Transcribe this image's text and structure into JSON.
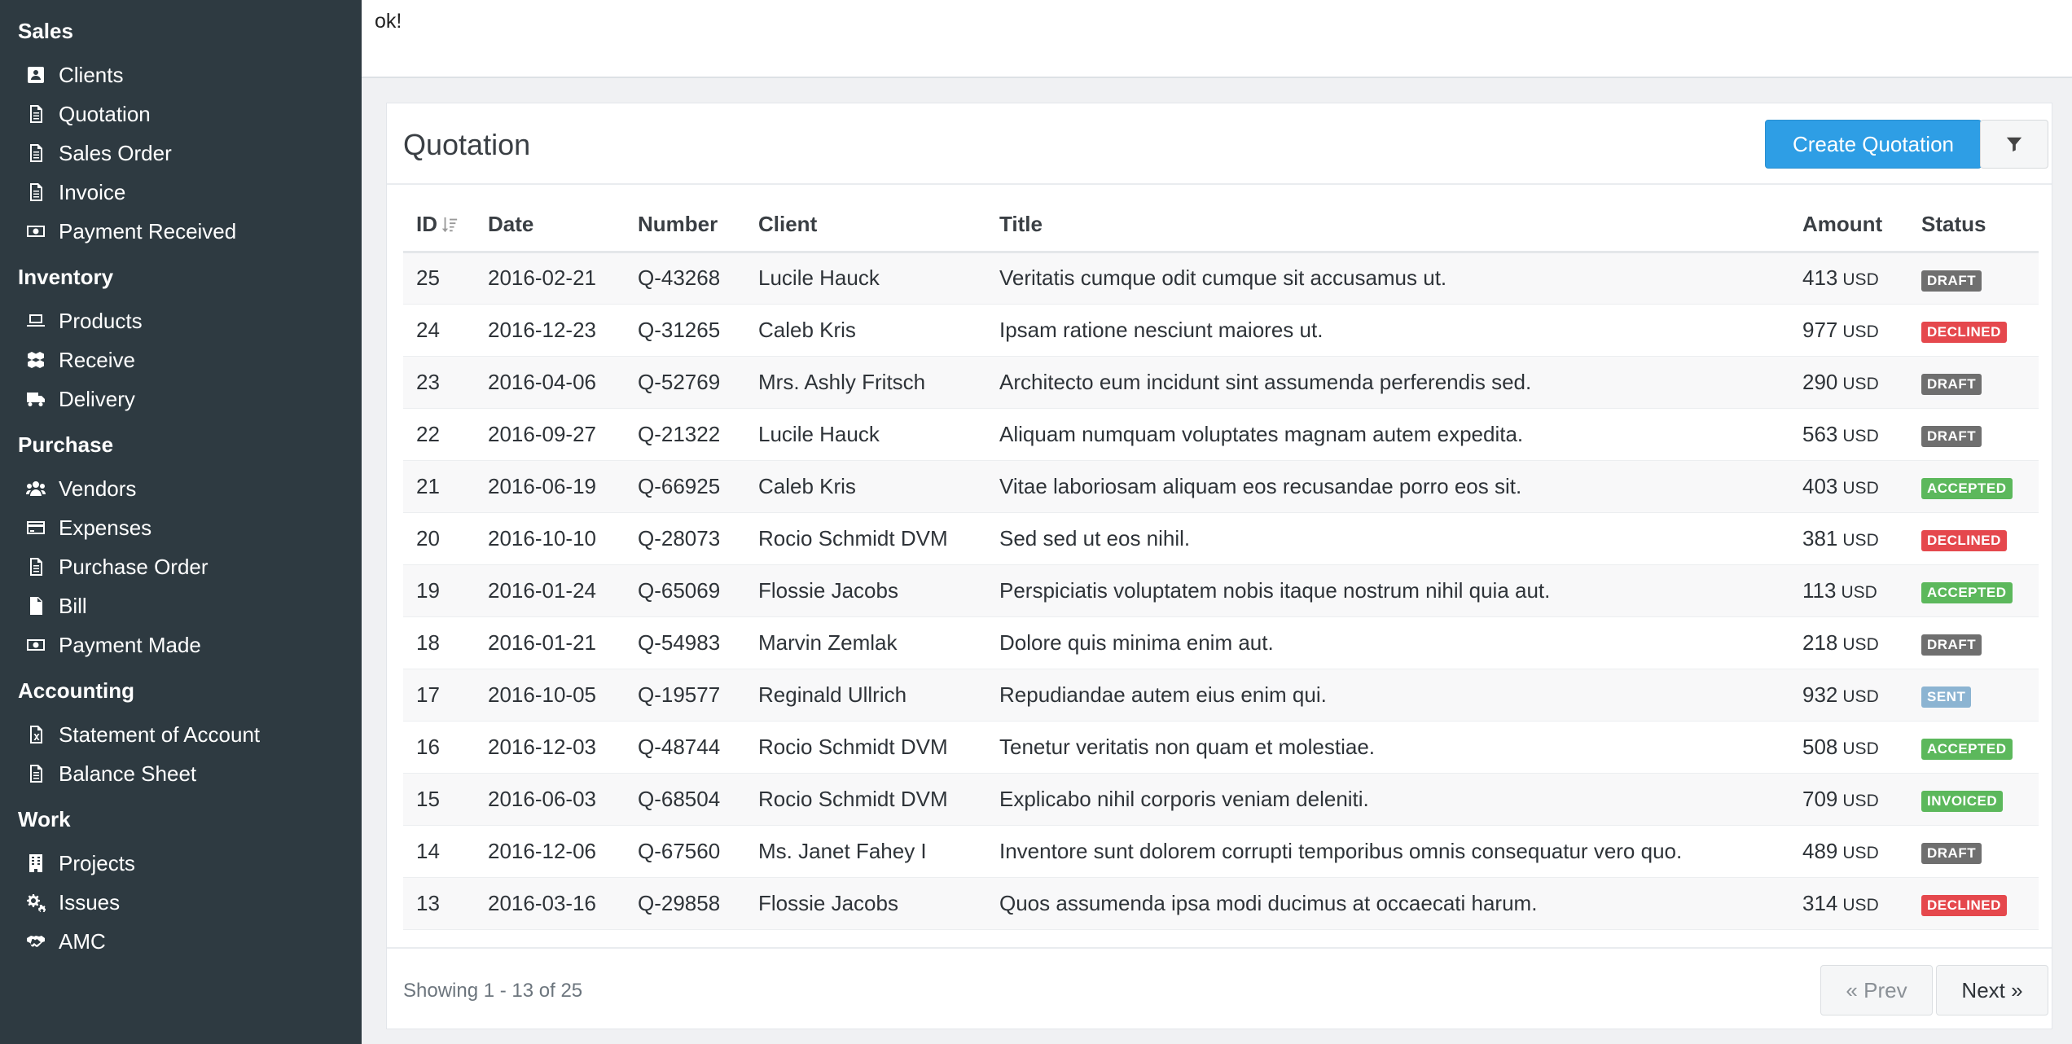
{
  "topbar": {
    "message": "ok!"
  },
  "sidebar": {
    "sections": [
      {
        "title": "Sales",
        "items": [
          {
            "label": "Clients",
            "icon": "address-card-icon"
          },
          {
            "label": "Quotation",
            "icon": "document-icon"
          },
          {
            "label": "Sales Order",
            "icon": "document-icon"
          },
          {
            "label": "Invoice",
            "icon": "document-icon"
          },
          {
            "label": "Payment Received",
            "icon": "money-icon"
          }
        ]
      },
      {
        "title": "Inventory",
        "items": [
          {
            "label": "Products",
            "icon": "laptop-icon"
          },
          {
            "label": "Receive",
            "icon": "cubes-icon"
          },
          {
            "label": "Delivery",
            "icon": "truck-icon"
          }
        ]
      },
      {
        "title": "Purchase",
        "items": [
          {
            "label": "Vendors",
            "icon": "users-icon"
          },
          {
            "label": "Expenses",
            "icon": "credit-card-icon"
          },
          {
            "label": "Purchase Order",
            "icon": "document-icon"
          },
          {
            "label": "Bill",
            "icon": "document-filled-icon"
          },
          {
            "label": "Payment Made",
            "icon": "money-icon"
          }
        ]
      },
      {
        "title": "Accounting",
        "items": [
          {
            "label": "Statement of Account",
            "icon": "excel-file-icon"
          },
          {
            "label": "Balance Sheet",
            "icon": "document-icon"
          }
        ]
      },
      {
        "title": "Work",
        "items": [
          {
            "label": "Projects",
            "icon": "building-icon"
          },
          {
            "label": "Issues",
            "icon": "cogs-icon"
          },
          {
            "label": "AMC",
            "icon": "handshake-icon"
          }
        ]
      }
    ]
  },
  "panel": {
    "title": "Quotation",
    "create_label": "Create Quotation",
    "filter_icon": "filter-icon"
  },
  "table": {
    "columns": [
      "ID",
      "Date",
      "Number",
      "Client",
      "Title",
      "Amount",
      "Status"
    ],
    "currency": "USD",
    "rows": [
      {
        "id": "25",
        "date": "2016-02-21",
        "number": "Q-43268",
        "client": "Lucile Hauck",
        "title": "Veritatis cumque odit cumque sit accusamus ut.",
        "amount": "413",
        "status": "DRAFT"
      },
      {
        "id": "24",
        "date": "2016-12-23",
        "number": "Q-31265",
        "client": "Caleb Kris",
        "title": "Ipsam ratione nesciunt maiores ut.",
        "amount": "977",
        "status": "DECLINED"
      },
      {
        "id": "23",
        "date": "2016-04-06",
        "number": "Q-52769",
        "client": "Mrs. Ashly Fritsch",
        "title": "Architecto eum incidunt sint assumenda perferendis sed.",
        "amount": "290",
        "status": "DRAFT"
      },
      {
        "id": "22",
        "date": "2016-09-27",
        "number": "Q-21322",
        "client": "Lucile Hauck",
        "title": "Aliquam numquam voluptates magnam autem expedita.",
        "amount": "563",
        "status": "DRAFT"
      },
      {
        "id": "21",
        "date": "2016-06-19",
        "number": "Q-66925",
        "client": "Caleb Kris",
        "title": "Vitae laboriosam aliquam eos recusandae porro eos sit.",
        "amount": "403",
        "status": "ACCEPTED"
      },
      {
        "id": "20",
        "date": "2016-10-10",
        "number": "Q-28073",
        "client": "Rocio Schmidt DVM",
        "title": "Sed sed ut eos nihil.",
        "amount": "381",
        "status": "DECLINED"
      },
      {
        "id": "19",
        "date": "2016-01-24",
        "number": "Q-65069",
        "client": "Flossie Jacobs",
        "title": "Perspiciatis voluptatem nobis itaque nostrum nihil quia aut.",
        "amount": "113",
        "status": "ACCEPTED"
      },
      {
        "id": "18",
        "date": "2016-01-21",
        "number": "Q-54983",
        "client": "Marvin Zemlak",
        "title": "Dolore quis minima enim aut.",
        "amount": "218",
        "status": "DRAFT"
      },
      {
        "id": "17",
        "date": "2016-10-05",
        "number": "Q-19577",
        "client": "Reginald Ullrich",
        "title": "Repudiandae autem eius enim qui.",
        "amount": "932",
        "status": "SENT"
      },
      {
        "id": "16",
        "date": "2016-12-03",
        "number": "Q-48744",
        "client": "Rocio Schmidt DVM",
        "title": "Tenetur veritatis non quam et molestiae.",
        "amount": "508",
        "status": "ACCEPTED"
      },
      {
        "id": "15",
        "date": "2016-06-03",
        "number": "Q-68504",
        "client": "Rocio Schmidt DVM",
        "title": "Explicabo nihil corporis veniam deleniti.",
        "amount": "709",
        "status": "INVOICED"
      },
      {
        "id": "14",
        "date": "2016-12-06",
        "number": "Q-67560",
        "client": "Ms. Janet Fahey I",
        "title": "Inventore sunt dolorem corrupti temporibus omnis consequatur vero quo.",
        "amount": "489",
        "status": "DRAFT"
      },
      {
        "id": "13",
        "date": "2016-03-16",
        "number": "Q-29858",
        "client": "Flossie Jacobs",
        "title": "Quos assumenda ipsa modi ducimus at occaecati harum.",
        "amount": "314",
        "status": "DECLINED"
      }
    ]
  },
  "status_colors": {
    "DRAFT": "#6f6f6f",
    "DECLINED": "#e5484d",
    "ACCEPTED": "#5cb85c",
    "SENT": "#8cb4d2",
    "INVOICED": "#5cb85c"
  },
  "footer": {
    "showing": "Showing 1 - 13 of 25",
    "prev_label": "« Prev",
    "next_label": "Next »"
  }
}
